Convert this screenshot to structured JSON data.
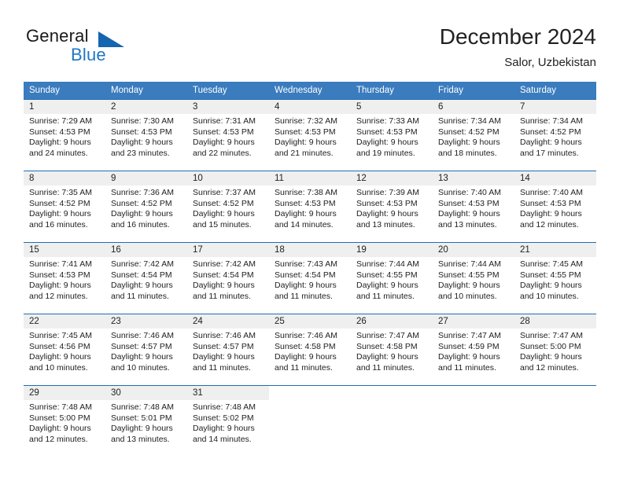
{
  "brand": {
    "name_part1": "General",
    "name_part2": "Blue",
    "logo_icon": "triangle-flag-icon"
  },
  "header": {
    "title": "December 2024",
    "subtitle": "Salor, Uzbekistan"
  },
  "weekday_headers": [
    "Sunday",
    "Monday",
    "Tuesday",
    "Wednesday",
    "Thursday",
    "Friday",
    "Saturday"
  ],
  "colors": {
    "header_blue": "#3a7cbe",
    "rule_blue": "#1f6db5",
    "daynum_band": "#efefef",
    "brand_blue": "#1f77c4",
    "text": "#222222"
  },
  "weeks": [
    [
      {
        "day": "1",
        "sunrise": "Sunrise: 7:29 AM",
        "sunset": "Sunset: 4:53 PM",
        "daylight1": "Daylight: 9 hours",
        "daylight2": "and 24 minutes."
      },
      {
        "day": "2",
        "sunrise": "Sunrise: 7:30 AM",
        "sunset": "Sunset: 4:53 PM",
        "daylight1": "Daylight: 9 hours",
        "daylight2": "and 23 minutes."
      },
      {
        "day": "3",
        "sunrise": "Sunrise: 7:31 AM",
        "sunset": "Sunset: 4:53 PM",
        "daylight1": "Daylight: 9 hours",
        "daylight2": "and 22 minutes."
      },
      {
        "day": "4",
        "sunrise": "Sunrise: 7:32 AM",
        "sunset": "Sunset: 4:53 PM",
        "daylight1": "Daylight: 9 hours",
        "daylight2": "and 21 minutes."
      },
      {
        "day": "5",
        "sunrise": "Sunrise: 7:33 AM",
        "sunset": "Sunset: 4:53 PM",
        "daylight1": "Daylight: 9 hours",
        "daylight2": "and 19 minutes."
      },
      {
        "day": "6",
        "sunrise": "Sunrise: 7:34 AM",
        "sunset": "Sunset: 4:52 PM",
        "daylight1": "Daylight: 9 hours",
        "daylight2": "and 18 minutes."
      },
      {
        "day": "7",
        "sunrise": "Sunrise: 7:34 AM",
        "sunset": "Sunset: 4:52 PM",
        "daylight1": "Daylight: 9 hours",
        "daylight2": "and 17 minutes."
      }
    ],
    [
      {
        "day": "8",
        "sunrise": "Sunrise: 7:35 AM",
        "sunset": "Sunset: 4:52 PM",
        "daylight1": "Daylight: 9 hours",
        "daylight2": "and 16 minutes."
      },
      {
        "day": "9",
        "sunrise": "Sunrise: 7:36 AM",
        "sunset": "Sunset: 4:52 PM",
        "daylight1": "Daylight: 9 hours",
        "daylight2": "and 16 minutes."
      },
      {
        "day": "10",
        "sunrise": "Sunrise: 7:37 AM",
        "sunset": "Sunset: 4:52 PM",
        "daylight1": "Daylight: 9 hours",
        "daylight2": "and 15 minutes."
      },
      {
        "day": "11",
        "sunrise": "Sunrise: 7:38 AM",
        "sunset": "Sunset: 4:53 PM",
        "daylight1": "Daylight: 9 hours",
        "daylight2": "and 14 minutes."
      },
      {
        "day": "12",
        "sunrise": "Sunrise: 7:39 AM",
        "sunset": "Sunset: 4:53 PM",
        "daylight1": "Daylight: 9 hours",
        "daylight2": "and 13 minutes."
      },
      {
        "day": "13",
        "sunrise": "Sunrise: 7:40 AM",
        "sunset": "Sunset: 4:53 PM",
        "daylight1": "Daylight: 9 hours",
        "daylight2": "and 13 minutes."
      },
      {
        "day": "14",
        "sunrise": "Sunrise: 7:40 AM",
        "sunset": "Sunset: 4:53 PM",
        "daylight1": "Daylight: 9 hours",
        "daylight2": "and 12 minutes."
      }
    ],
    [
      {
        "day": "15",
        "sunrise": "Sunrise: 7:41 AM",
        "sunset": "Sunset: 4:53 PM",
        "daylight1": "Daylight: 9 hours",
        "daylight2": "and 12 minutes."
      },
      {
        "day": "16",
        "sunrise": "Sunrise: 7:42 AM",
        "sunset": "Sunset: 4:54 PM",
        "daylight1": "Daylight: 9 hours",
        "daylight2": "and 11 minutes."
      },
      {
        "day": "17",
        "sunrise": "Sunrise: 7:42 AM",
        "sunset": "Sunset: 4:54 PM",
        "daylight1": "Daylight: 9 hours",
        "daylight2": "and 11 minutes."
      },
      {
        "day": "18",
        "sunrise": "Sunrise: 7:43 AM",
        "sunset": "Sunset: 4:54 PM",
        "daylight1": "Daylight: 9 hours",
        "daylight2": "and 11 minutes."
      },
      {
        "day": "19",
        "sunrise": "Sunrise: 7:44 AM",
        "sunset": "Sunset: 4:55 PM",
        "daylight1": "Daylight: 9 hours",
        "daylight2": "and 11 minutes."
      },
      {
        "day": "20",
        "sunrise": "Sunrise: 7:44 AM",
        "sunset": "Sunset: 4:55 PM",
        "daylight1": "Daylight: 9 hours",
        "daylight2": "and 10 minutes."
      },
      {
        "day": "21",
        "sunrise": "Sunrise: 7:45 AM",
        "sunset": "Sunset: 4:55 PM",
        "daylight1": "Daylight: 9 hours",
        "daylight2": "and 10 minutes."
      }
    ],
    [
      {
        "day": "22",
        "sunrise": "Sunrise: 7:45 AM",
        "sunset": "Sunset: 4:56 PM",
        "daylight1": "Daylight: 9 hours",
        "daylight2": "and 10 minutes."
      },
      {
        "day": "23",
        "sunrise": "Sunrise: 7:46 AM",
        "sunset": "Sunset: 4:57 PM",
        "daylight1": "Daylight: 9 hours",
        "daylight2": "and 10 minutes."
      },
      {
        "day": "24",
        "sunrise": "Sunrise: 7:46 AM",
        "sunset": "Sunset: 4:57 PM",
        "daylight1": "Daylight: 9 hours",
        "daylight2": "and 11 minutes."
      },
      {
        "day": "25",
        "sunrise": "Sunrise: 7:46 AM",
        "sunset": "Sunset: 4:58 PM",
        "daylight1": "Daylight: 9 hours",
        "daylight2": "and 11 minutes."
      },
      {
        "day": "26",
        "sunrise": "Sunrise: 7:47 AM",
        "sunset": "Sunset: 4:58 PM",
        "daylight1": "Daylight: 9 hours",
        "daylight2": "and 11 minutes."
      },
      {
        "day": "27",
        "sunrise": "Sunrise: 7:47 AM",
        "sunset": "Sunset: 4:59 PM",
        "daylight1": "Daylight: 9 hours",
        "daylight2": "and 11 minutes."
      },
      {
        "day": "28",
        "sunrise": "Sunrise: 7:47 AM",
        "sunset": "Sunset: 5:00 PM",
        "daylight1": "Daylight: 9 hours",
        "daylight2": "and 12 minutes."
      }
    ],
    [
      {
        "day": "29",
        "sunrise": "Sunrise: 7:48 AM",
        "sunset": "Sunset: 5:00 PM",
        "daylight1": "Daylight: 9 hours",
        "daylight2": "and 12 minutes."
      },
      {
        "day": "30",
        "sunrise": "Sunrise: 7:48 AM",
        "sunset": "Sunset: 5:01 PM",
        "daylight1": "Daylight: 9 hours",
        "daylight2": "and 13 minutes."
      },
      {
        "day": "31",
        "sunrise": "Sunrise: 7:48 AM",
        "sunset": "Sunset: 5:02 PM",
        "daylight1": "Daylight: 9 hours",
        "daylight2": "and 14 minutes."
      },
      {
        "day": "",
        "sunrise": "",
        "sunset": "",
        "daylight1": "",
        "daylight2": ""
      },
      {
        "day": "",
        "sunrise": "",
        "sunset": "",
        "daylight1": "",
        "daylight2": ""
      },
      {
        "day": "",
        "sunrise": "",
        "sunset": "",
        "daylight1": "",
        "daylight2": ""
      },
      {
        "day": "",
        "sunrise": "",
        "sunset": "",
        "daylight1": "",
        "daylight2": ""
      }
    ]
  ]
}
